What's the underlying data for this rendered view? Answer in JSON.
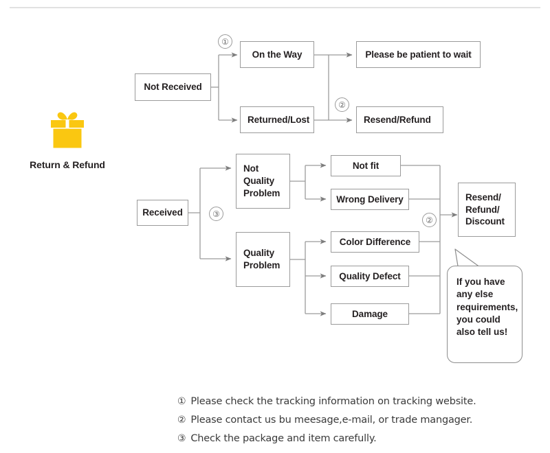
{
  "page": {
    "title": "Return & Refund process flowchart",
    "line_color": "#9a9a9a",
    "text_color": "#231f20",
    "accent_color": "#fac711",
    "divider_color": "#e0e0e0"
  },
  "brand": {
    "icon": "gift-box-icon",
    "label": "Return & Refund"
  },
  "flow": {
    "not_received": {
      "label": "Not Received",
      "branches": [
        {
          "label": "On the Way",
          "outcome": "Please be patient to wait",
          "marker": "①"
        },
        {
          "label": "Returned/Lost",
          "outcome": "Resend/Refund",
          "marker": "②"
        }
      ]
    },
    "received": {
      "label": "Received",
      "marker": "③",
      "groups": [
        {
          "label": "Not Quality Problem",
          "items": [
            "Not fit",
            "Wrong Delivery"
          ]
        },
        {
          "label": "Quality Problem",
          "items": [
            "Color Difference",
            "Quality Defect",
            "Damage"
          ]
        }
      ],
      "outcome": "Resend/ Refund/ Discount",
      "outcome_marker": "②"
    }
  },
  "nodes": {
    "not_received": "Not Received",
    "on_the_way": "On the Way",
    "returned_lost": "Returned/Lost",
    "please_wait": "Please be patient to wait",
    "resend_refund": "Resend/Refund",
    "received": "Received",
    "not_quality_problem": "Not\nQuality\nProblem",
    "quality_problem": "Quality\nProblem",
    "not_fit": "Not fit",
    "wrong_delivery": "Wrong Delivery",
    "color_difference": "Color Difference",
    "quality_defect": "Quality Defect",
    "damage": "Damage",
    "resend_refund_discount": "Resend/\nRefund/\nDiscount"
  },
  "markers": {
    "one": "①",
    "two_top": "②",
    "three": "③",
    "two_bottom": "②"
  },
  "callout": {
    "text": "If you have any else requirements, you could also tell us!"
  },
  "notes": [
    {
      "marker": "①",
      "text": "Please check the tracking information on tracking website."
    },
    {
      "marker": "②",
      "text": "Please contact us bu meesage,e-mail, or trade mangager."
    },
    {
      "marker": "③",
      "text": "Check the package and item carefully."
    }
  ]
}
